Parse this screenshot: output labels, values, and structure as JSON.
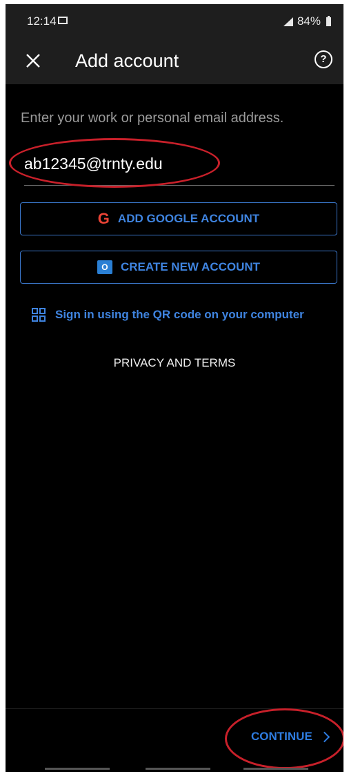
{
  "status_bar": {
    "time": "12:14",
    "battery": "84%"
  },
  "app_bar": {
    "title": "Add account"
  },
  "form": {
    "prompt": "Enter your work or personal email address.",
    "email_value": "ab12345@trnty.edu"
  },
  "buttons": {
    "google": "ADD GOOGLE ACCOUNT",
    "create": "CREATE NEW ACCOUNT"
  },
  "qr_link": "Sign in using the QR code on your computer",
  "privacy": "PRIVACY AND TERMS",
  "footer": {
    "continue": "CONTINUE"
  },
  "icons": [
    "close-icon",
    "help-icon",
    "google-icon",
    "outlook-icon",
    "qr-code-icon",
    "chevron-right-icon"
  ],
  "colors": {
    "accent": "#3f84e0",
    "annotation": "#c8202a",
    "background": "#000000"
  }
}
